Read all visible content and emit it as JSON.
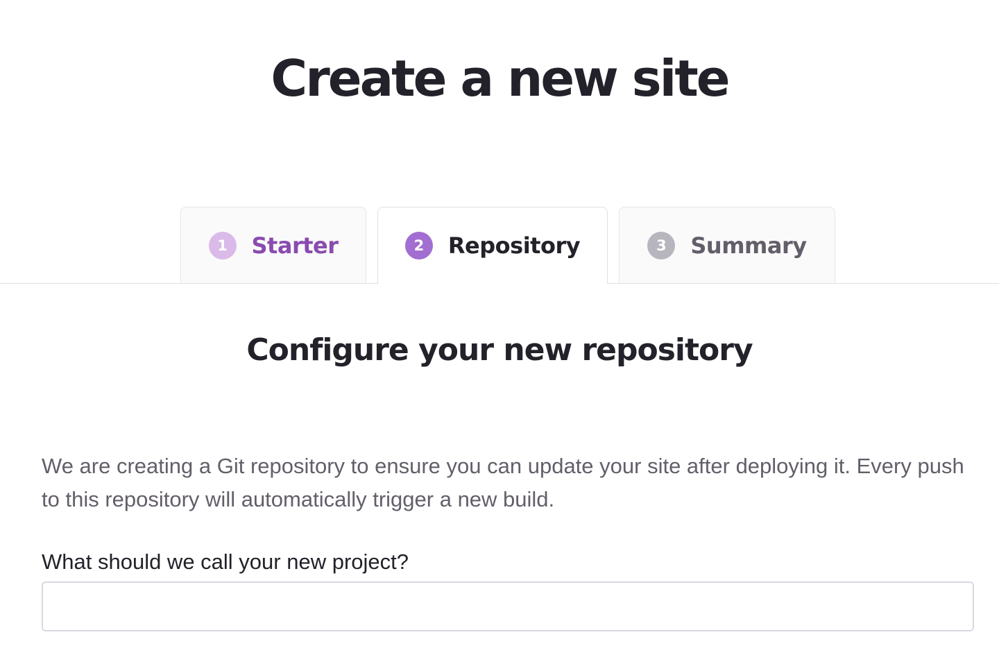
{
  "page": {
    "title": "Create a new site"
  },
  "steps": [
    {
      "number": "1",
      "label": "Starter",
      "state": "completed",
      "badge_color": "#d9bae8",
      "label_color": "#8a4baf"
    },
    {
      "number": "2",
      "label": "Repository",
      "state": "active",
      "badge_color": "#a26ed1",
      "label_color": "#232129"
    },
    {
      "number": "3",
      "label": "Summary",
      "state": "upcoming",
      "badge_color": "#b7b5bd",
      "label_color": "#635e69"
    }
  ],
  "section": {
    "title": "Configure your new repository",
    "description": "We are creating a Git repository to ensure you can update your site after deploying it. Every push to this repository will automatically trigger a new build."
  },
  "form": {
    "project_name_label": "What should we call your new project?",
    "project_name_value": ""
  }
}
